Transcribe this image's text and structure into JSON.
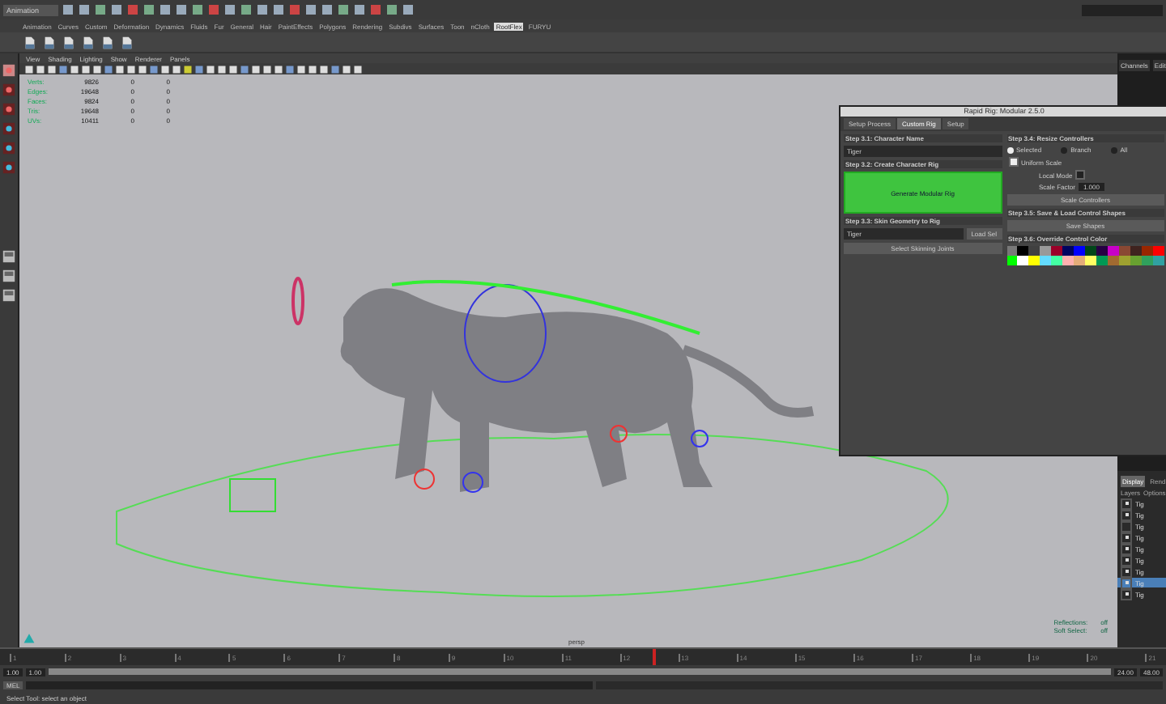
{
  "status_line": {
    "menu_set": "Animation"
  },
  "shelf_tabs": [
    {
      "label": "Animation",
      "selected": false
    },
    {
      "label": "Curves",
      "selected": false
    },
    {
      "label": "Custom",
      "selected": false
    },
    {
      "label": "Deformation",
      "selected": false
    },
    {
      "label": "Dynamics",
      "selected": false
    },
    {
      "label": "Fluids",
      "selected": false
    },
    {
      "label": "Fur",
      "selected": false
    },
    {
      "label": "General",
      "selected": false
    },
    {
      "label": "Hair",
      "selected": false
    },
    {
      "label": "PaintEffects",
      "selected": false
    },
    {
      "label": "Polygons",
      "selected": false
    },
    {
      "label": "Rendering",
      "selected": false
    },
    {
      "label": "Subdivs",
      "selected": false
    },
    {
      "label": "Surfaces",
      "selected": false
    },
    {
      "label": "Toon",
      "selected": false
    },
    {
      "label": "nCloth",
      "selected": false
    },
    {
      "label": "RootFlex",
      "selected": true
    },
    {
      "label": "FURYU",
      "selected": false
    }
  ],
  "viewport": {
    "menu": [
      "View",
      "Shading",
      "Lighting",
      "Show",
      "Renderer",
      "Panels"
    ],
    "stats": [
      {
        "label": "Verts:",
        "values": [
          "9826",
          "0",
          "0"
        ]
      },
      {
        "label": "Edges:",
        "values": [
          "19648",
          "0",
          "0"
        ]
      },
      {
        "label": "Faces:",
        "values": [
          "9824",
          "0",
          "0"
        ]
      },
      {
        "label": "Tris:",
        "values": [
          "19648",
          "0",
          "0"
        ]
      },
      {
        "label": "UVs:",
        "values": [
          "10411",
          "0",
          "0"
        ]
      }
    ],
    "hud_right": [
      {
        "label": "Reflections:",
        "value": "off"
      },
      {
        "label": "Soft Select:",
        "value": "off"
      }
    ],
    "camera": "persp"
  },
  "channel_box": {
    "tabs": [
      "Channels",
      "Edit"
    ]
  },
  "layer_editor": {
    "tabs": [
      {
        "label": "Display",
        "selected": true
      },
      {
        "label": "Rend",
        "selected": false
      }
    ],
    "menu": [
      "Layers",
      "Options"
    ],
    "items": [
      {
        "label": "Tig",
        "visible": true,
        "selected": false
      },
      {
        "label": "Tig",
        "visible": true,
        "selected": false
      },
      {
        "label": "Tig",
        "visible": false,
        "selected": false
      },
      {
        "label": "Tig",
        "visible": true,
        "selected": false
      },
      {
        "label": "Tig",
        "visible": true,
        "selected": false
      },
      {
        "label": "Tig",
        "visible": true,
        "selected": false
      },
      {
        "label": "Tig",
        "visible": true,
        "selected": false
      },
      {
        "label": "Tig",
        "visible": true,
        "selected": true
      },
      {
        "label": "Tig",
        "visible": true,
        "selected": false
      }
    ]
  },
  "timeline": {
    "ticks": [
      "1",
      "2",
      "3",
      "4",
      "5",
      "6",
      "7",
      "8",
      "9",
      "10",
      "11",
      "12",
      "13",
      "14",
      "15",
      "16",
      "17",
      "18",
      "19",
      "20",
      "21"
    ],
    "level": 0.56,
    "range": {
      "level": 1
    },
    "start": "1.00",
    "range_start": "1.00",
    "range_end": "24.00",
    "end": "48.00"
  },
  "command_line": {
    "label": "MEL"
  },
  "help_line": "Select Tool: select an object",
  "rig_window": {
    "title": "Rapid Rig: Modular 2.5.0",
    "tabs": [
      {
        "label": "Setup Process",
        "selected": false
      },
      {
        "label": "Custom Rig",
        "selected": true
      },
      {
        "label": "Setup",
        "selected": false
      }
    ],
    "step_name": {
      "label": "Step 3.1: Character Name",
      "value": "Tiger"
    },
    "step_create": {
      "label": "Step 3.2: Create Character Rig",
      "button": "Generate Modular Rig"
    },
    "step_skin": {
      "label": "Step 3.3: Skin Geometry to Rig",
      "value": "Tiger",
      "load_button": "Load Sel",
      "select_button": "Select Skinning Joints"
    },
    "step_resize": {
      "label": "Step 3.4: Resize Controllers",
      "options": [
        {
          "label": "Selected",
          "selected": true
        },
        {
          "label": "Branch",
          "selected": false
        },
        {
          "label": "All",
          "selected": false
        }
      ],
      "uniform_scale": {
        "label": "Uniform Scale",
        "checked": true
      },
      "local_mode": {
        "label": "Local Mode",
        "checked": false
      },
      "scale_factor": {
        "label": "Scale Factor",
        "value": "1.000"
      },
      "button": "Scale Controllers"
    },
    "step_save": {
      "label": "Step 3.5: Save & Load Control Shapes",
      "button": "Save Shapes"
    },
    "step_color": {
      "label": "Step 3.6: Override Control Color",
      "colors": [
        {
          "color": "#787878"
        },
        {
          "color": "#000000"
        },
        {
          "color": "#404040"
        },
        {
          "color": "#999999"
        },
        {
          "color": "#9b0028"
        },
        {
          "color": "#000460"
        },
        {
          "color": "#0000ff"
        },
        {
          "color": "#004619"
        },
        {
          "color": "#260043"
        },
        {
          "color": "#c800c8"
        },
        {
          "color": "#8a4833"
        },
        {
          "color": "#3f231f"
        },
        {
          "color": "#992600"
        },
        {
          "color": "#ff0000"
        },
        {
          "color": "#00ff00"
        },
        {
          "color": "#ffffff"
        },
        {
          "color": "#ffff00"
        },
        {
          "color": "#64dcff"
        },
        {
          "color": "#43ffa3"
        },
        {
          "color": "#ffb0b0"
        },
        {
          "color": "#e4ac79"
        },
        {
          "color": "#ffff63"
        },
        {
          "color": "#009954"
        },
        {
          "color": "#a16a30"
        },
        {
          "color": "#9ea130"
        },
        {
          "color": "#68a130"
        },
        {
          "color": "#30a15d"
        },
        {
          "color": "#30a1a1"
        }
      ]
    }
  }
}
